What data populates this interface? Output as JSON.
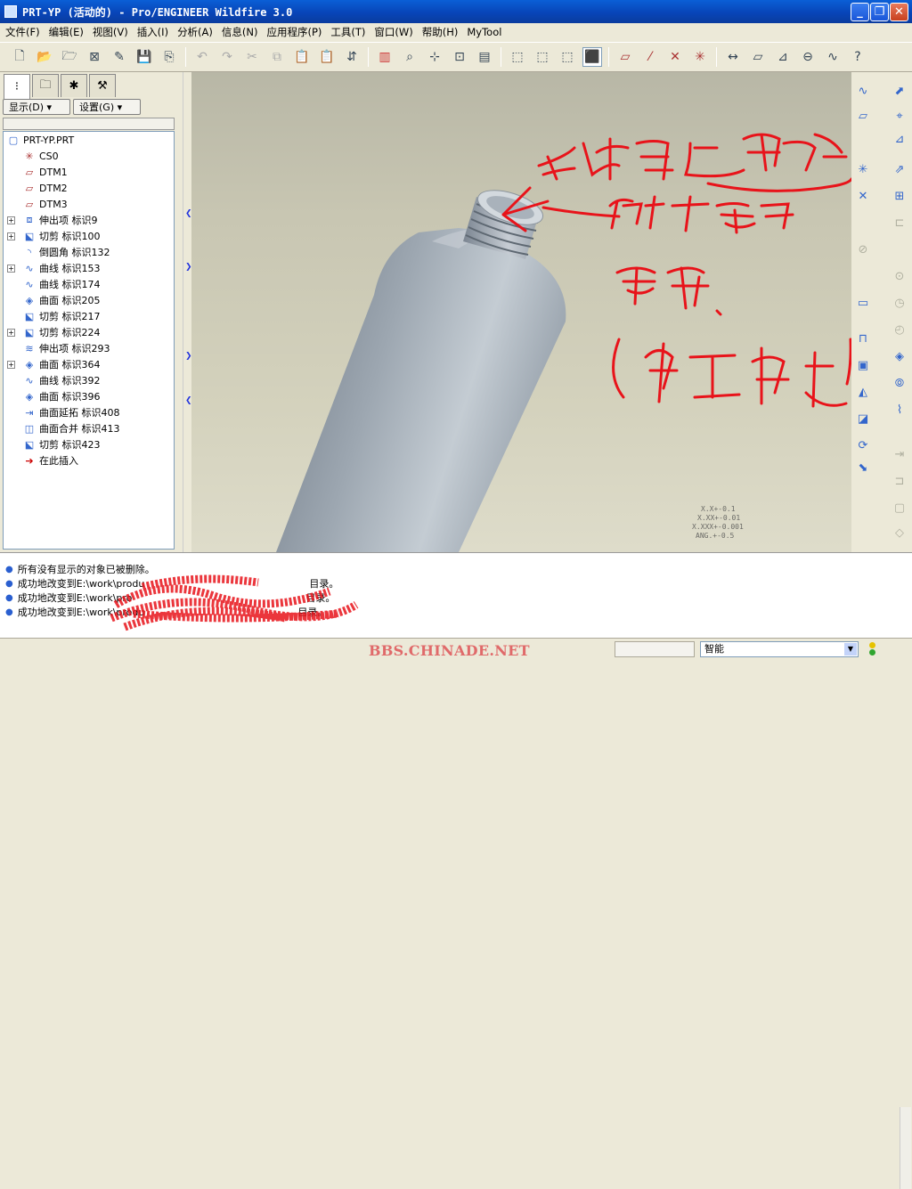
{
  "window": {
    "title": "PRT-YP (活动的) - Pro/ENGINEER Wildfire 3.0",
    "controls": {
      "minimize": "_",
      "maximize": "❐",
      "close": "✕"
    }
  },
  "menu": [
    "文件(F)",
    "编辑(E)",
    "视图(V)",
    "插入(I)",
    "分析(A)",
    "信息(N)",
    "应用程序(P)",
    "工具(T)",
    "窗口(W)",
    "帮助(H)",
    "MyTool"
  ],
  "navigator": {
    "display_label": "显示(D) ▾",
    "settings_label": "设置(G) ▾"
  },
  "tree": {
    "root": "PRT-YP.PRT",
    "items": [
      {
        "label": "CS0",
        "icon": "csys-icon",
        "expandable": false
      },
      {
        "label": "DTM1",
        "icon": "datum-plane-icon",
        "expandable": false
      },
      {
        "label": "DTM2",
        "icon": "datum-plane-icon",
        "expandable": false
      },
      {
        "label": "DTM3",
        "icon": "datum-plane-icon",
        "expandable": false
      },
      {
        "label": "伸出项 标识9",
        "icon": "protrusion-icon",
        "expandable": true
      },
      {
        "label": "切剪 标识100",
        "icon": "cut-icon",
        "expandable": true
      },
      {
        "label": "倒圆角 标识132",
        "icon": "round-icon",
        "expandable": false
      },
      {
        "label": "曲线 标识153",
        "icon": "curve-icon",
        "expandable": true
      },
      {
        "label": "曲线 标识174",
        "icon": "curve-icon",
        "expandable": false
      },
      {
        "label": "曲面 标识205",
        "icon": "surface-icon",
        "expandable": false
      },
      {
        "label": "切剪 标识217",
        "icon": "cut-icon",
        "expandable": false
      },
      {
        "label": "切剪 标识224",
        "icon": "cut-icon",
        "expandable": true
      },
      {
        "label": "伸出项 标识293",
        "icon": "helical-sweep-icon",
        "expandable": false
      },
      {
        "label": "曲面 标识364",
        "icon": "surface-icon",
        "expandable": true
      },
      {
        "label": "曲线 标识392",
        "icon": "curve-icon",
        "expandable": false
      },
      {
        "label": "曲面 标识396",
        "icon": "surface-icon",
        "expandable": false
      },
      {
        "label": "曲面延拓 标识408",
        "icon": "extend-icon",
        "expandable": false
      },
      {
        "label": "曲面合并 标识413",
        "icon": "merge-icon",
        "expandable": false
      },
      {
        "label": "切剪 标识423",
        "icon": "cut-icon",
        "expandable": false
      },
      {
        "label": "在此插入",
        "icon": "insert-arrow-icon",
        "expandable": false
      }
    ]
  },
  "tolerances": [
    "X.X+-0.1",
    "X.XX+-0.01",
    "X.XXX+-0.001",
    "ANG.+-0.5"
  ],
  "annotations": {
    "colors": {
      "ink": "#e8131a"
    }
  },
  "messages": [
    "所有没有显示的对象已被删除。",
    "成功地改变到E:\\work\\produ",
    "成功地改变到E:\\work\\pro",
    "成功地改变到E:\\work\\produ"
  ],
  "message_suffix": [
    "目录。",
    "目录。",
    "目录。"
  ],
  "status": {
    "watermark": "BBS.CHINADE.NET",
    "filter_value": "智能"
  }
}
